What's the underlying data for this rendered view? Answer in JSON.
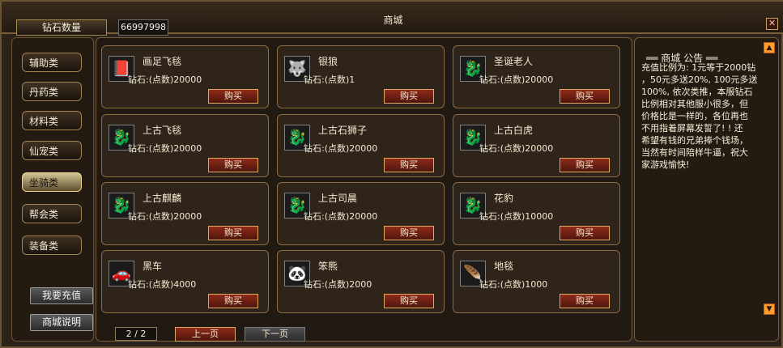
{
  "window": {
    "title": "商城",
    "close_glyph": "✕"
  },
  "diamond": {
    "label": "钻石数量",
    "value": "66997998"
  },
  "sidebar": {
    "categories": [
      "辅助类",
      "丹药类",
      "材料类",
      "仙宠类",
      "坐骑类",
      "帮会类",
      "装备类"
    ],
    "active": "坐骑类",
    "recharge": "我要充值",
    "guide": "商城说明"
  },
  "items": [
    {
      "name": "画足飞毯",
      "price": "钻石:(点数)20000",
      "buy": "购买",
      "icon": "book-icon"
    },
    {
      "name": "银狼",
      "price": "钻石:(点数)1",
      "buy": "购买",
      "icon": "wolf-icon"
    },
    {
      "name": "圣诞老人",
      "price": "钻石:(点数)20000",
      "buy": "购买",
      "icon": "dragon-icon"
    },
    {
      "name": "上古飞毯",
      "price": "钻石:(点数)20000",
      "buy": "购买",
      "icon": "dragon-icon"
    },
    {
      "name": "上古石狮子",
      "price": "钻石:(点数)20000",
      "buy": "购买",
      "icon": "dragon-icon"
    },
    {
      "name": "上古白虎",
      "price": "钻石:(点数)20000",
      "buy": "购买",
      "icon": "dragon-icon"
    },
    {
      "name": "上古麒麟",
      "price": "钻石:(点数)20000",
      "buy": "购买",
      "icon": "dragon-icon"
    },
    {
      "name": "上古司晨",
      "price": "钻石:(点数)20000",
      "buy": "购买",
      "icon": "dragon-icon"
    },
    {
      "name": "花豹",
      "price": "钻石:(点数)10000",
      "buy": "购买",
      "icon": "dragon-icon"
    },
    {
      "name": "黑车",
      "price": "钻石:(点数)4000",
      "buy": "购买",
      "icon": "car-icon"
    },
    {
      "name": "笨熊",
      "price": "钻石:(点数)2000",
      "buy": "购买",
      "icon": "panda-icon"
    },
    {
      "name": "地毯",
      "price": "钻石:(点数)1000",
      "buy": "购买",
      "icon": "carpet-icon"
    }
  ],
  "pager": {
    "text": "2 / 2",
    "prev": "上一页",
    "next": "下一页"
  },
  "notice": {
    "title": "══ 商城 公告 ══",
    "body": "充值比例为: 1元等于2000钻\n，50元多送20%, 100元多送\n100%, 依次类推，本服钻石\n比例相对其他服小很多，但\n价格比是一样的，各位再也\n不用指着屏幕发誓了! ! 还\n希望有钱的兄弟捧个钱场，\n当然有时间陪样牛逼，祝大\n家游戏愉快!"
  }
}
